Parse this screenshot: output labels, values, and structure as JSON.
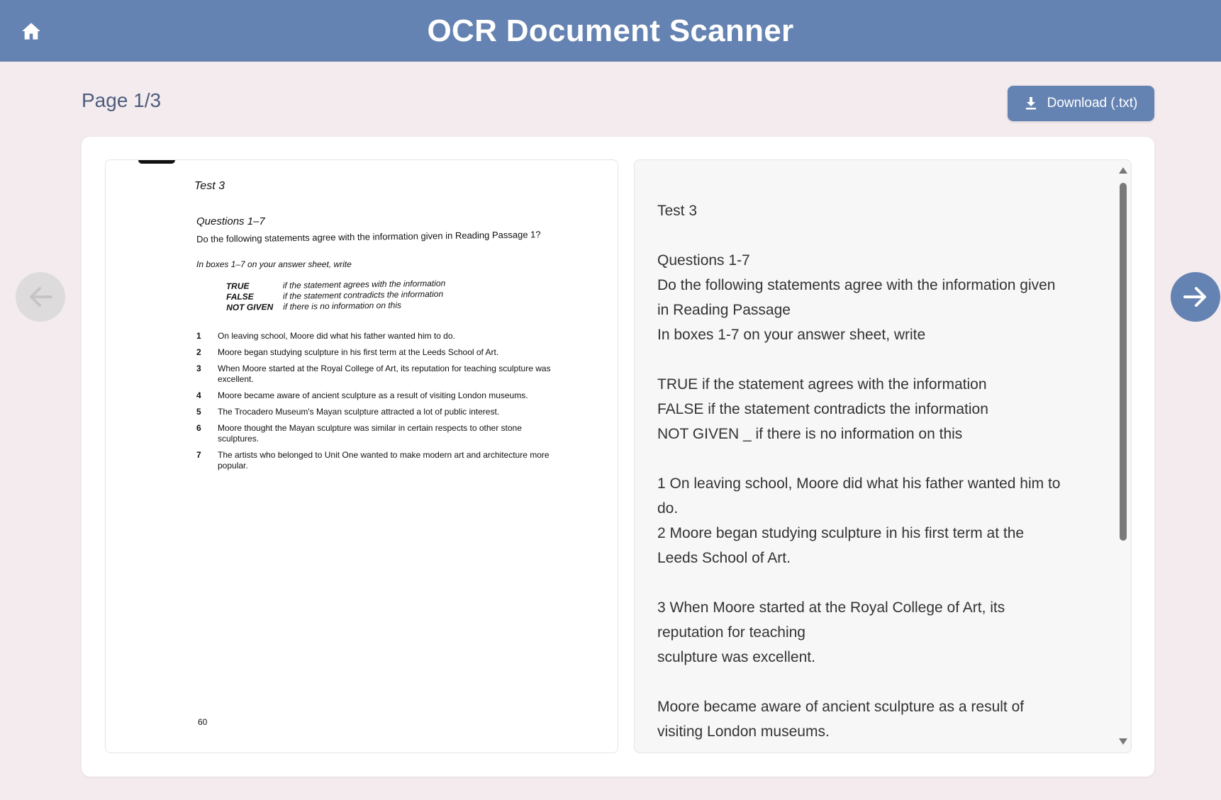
{
  "header": {
    "title": "OCR Document Scanner",
    "home_icon": "home-icon"
  },
  "toolbar": {
    "page_indicator": "Page 1/3",
    "download_label": "Download (.txt)",
    "download_icon": "download-icon"
  },
  "nav": {
    "prev_icon": "arrow-left-icon",
    "next_icon": "arrow-right-icon"
  },
  "scan": {
    "title": "Test 3",
    "questions": "Questions 1–7",
    "intro": "Do the following statements agree with the information given in Reading Passage 1?",
    "boxes": "In boxes 1–7 on your answer sheet, write",
    "legend": [
      {
        "key": "TRUE",
        "value": "if the statement agrees with the information"
      },
      {
        "key": "FALSE",
        "value": "if the statement contradicts the information"
      },
      {
        "key": "NOT GIVEN",
        "value": "if there is no information on this"
      }
    ],
    "items": [
      {
        "num": "1",
        "text": "On leaving school, Moore did what his father wanted him to do."
      },
      {
        "num": "2",
        "text": "Moore began studying sculpture in his first term at the Leeds School of Art."
      },
      {
        "num": "3",
        "text": "When Moore started at the Royal College of Art, its reputation for teaching sculpture was excellent."
      },
      {
        "num": "4",
        "text": "Moore became aware of ancient sculpture as a result of visiting London museums."
      },
      {
        "num": "5",
        "text": "The Trocadero Museum's Mayan sculpture attracted a lot of public interest."
      },
      {
        "num": "6",
        "text": "Moore thought the Mayan sculpture was similar in certain respects to other stone sculptures."
      },
      {
        "num": "7",
        "text": "The artists who belonged to Unit One wanted to make modern art and architecture more popular."
      }
    ],
    "page_number": "60"
  },
  "ocr_text": {
    "lines": [
      "Test 3",
      "",
      "Questions 1-7",
      "Do the following statements agree with the information given",
      "in Reading Passage",
      "In boxes 1-7 on your answer sheet, write",
      "",
      "TRUE if the statement agrees with the information",
      "FALSE if the statement contradicts the information",
      "NOT GIVEN _ if there is no information on this",
      "",
      "1 On leaving school, Moore did what his father wanted him to",
      "do.",
      "2 Moore began studying sculpture in his first term at the",
      "Leeds School of Art.",
      "",
      "3 When Moore started at the Royal College of Art, its",
      "reputation for teaching",
      "sculpture was excellent.",
      "",
      "Moore became aware of ancient sculpture as a result of",
      "visiting London museums."
    ]
  },
  "colors": {
    "header": "#6583b2",
    "background": "#f3ebee",
    "accent": "#6583b2"
  }
}
